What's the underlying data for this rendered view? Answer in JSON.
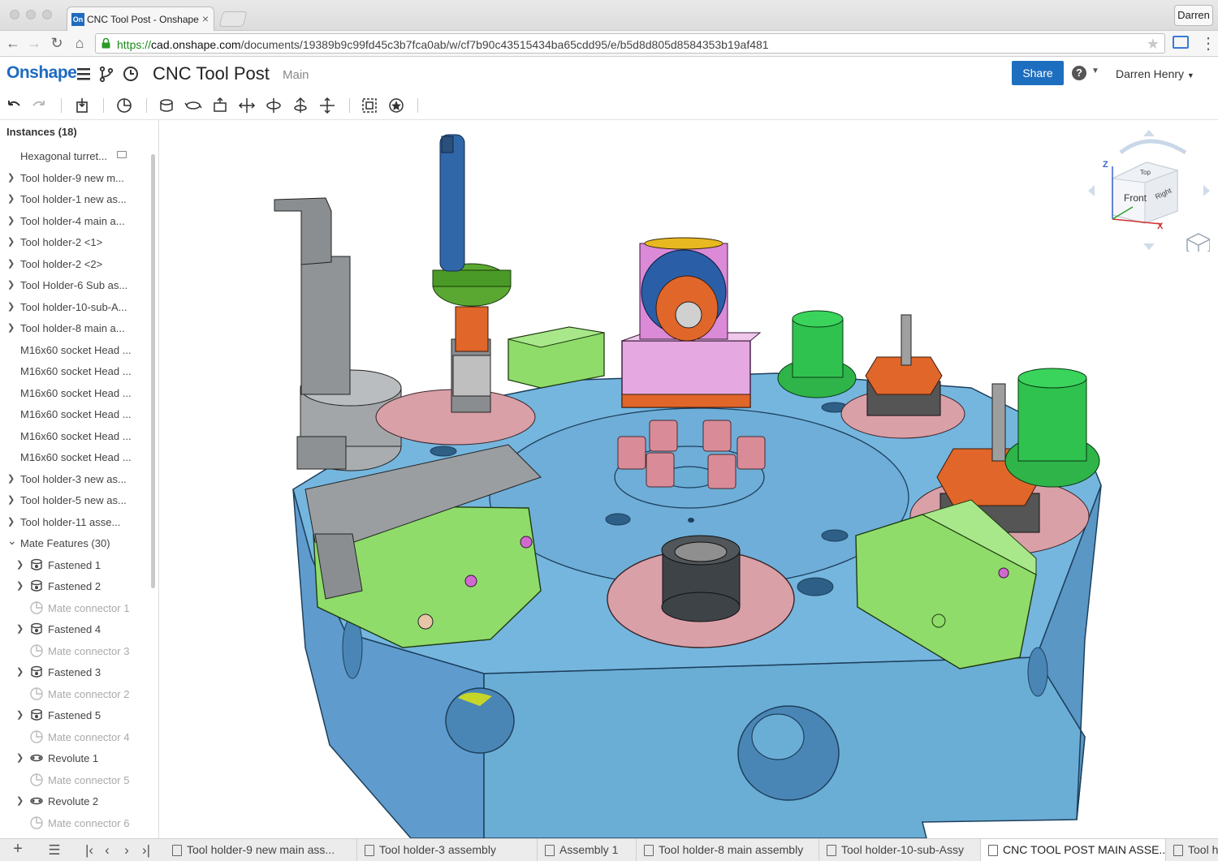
{
  "browser": {
    "tab_title": "CNC Tool Post - Onshape",
    "tab_favicon_text": "On",
    "profile_name": "Darren",
    "url_proto": "https://",
    "url_host": "cad.onshape.com",
    "url_path": "/documents/19389b9c99fd45c3b7fca0ab/w/cf7b90c43515434ba65cdd95/e/b5d8d805d8584353b19af481"
  },
  "header": {
    "logo": "Onshape",
    "doc_title": "CNC Tool Post",
    "branch": "Main",
    "share_label": "Share",
    "help_label": "?",
    "user_name": "Darren Henry"
  },
  "panel": {
    "instances_title": "Instances (18)",
    "instances": [
      {
        "label": "Hexagonal turret...",
        "expandable": false
      },
      {
        "label": "Tool holder-9 new m...",
        "expandable": true
      },
      {
        "label": "Tool holder-1 new as...",
        "expandable": true
      },
      {
        "label": "Tool holder-4 main a...",
        "expandable": true
      },
      {
        "label": "Tool holder-2 <1>",
        "expandable": true
      },
      {
        "label": "Tool holder-2 <2>",
        "expandable": true
      },
      {
        "label": "Tool Holder-6 Sub as...",
        "expandable": true
      },
      {
        "label": "Tool holder-10-sub-A...",
        "expandable": true
      },
      {
        "label": "Tool holder-8 main a...",
        "expandable": true
      },
      {
        "label": "M16x60 socket Head ...",
        "expandable": false
      },
      {
        "label": "M16x60 socket Head ...",
        "expandable": false
      },
      {
        "label": "M16x60 socket Head ...",
        "expandable": false
      },
      {
        "label": "M16x60 socket Head ...",
        "expandable": false
      },
      {
        "label": "M16x60 socket Head ...",
        "expandable": false
      },
      {
        "label": "M16x60 socket Head ...",
        "expandable": false
      },
      {
        "label": "Tool holder-3 new as...",
        "expandable": true
      },
      {
        "label": "Tool holder-5 new as...",
        "expandable": true
      },
      {
        "label": "Tool holder-11 asse...",
        "expandable": true
      }
    ],
    "mates_title": "Mate Features (30)",
    "mates": [
      {
        "label": "Fastened 1",
        "kind": "fastened",
        "dim": false
      },
      {
        "label": "Fastened 2",
        "kind": "fastened",
        "dim": false
      },
      {
        "label": "Mate connector 1",
        "kind": "connector",
        "dim": true
      },
      {
        "label": "Fastened 4",
        "kind": "fastened",
        "dim": false
      },
      {
        "label": "Mate connector 3",
        "kind": "connector",
        "dim": true
      },
      {
        "label": "Fastened 3",
        "kind": "fastened",
        "dim": false
      },
      {
        "label": "Mate connector 2",
        "kind": "connector",
        "dim": true
      },
      {
        "label": "Fastened 5",
        "kind": "fastened",
        "dim": false
      },
      {
        "label": "Mate connector 4",
        "kind": "connector",
        "dim": true
      },
      {
        "label": "Revolute 1",
        "kind": "revolute",
        "dim": false
      },
      {
        "label": "Mate connector 5",
        "kind": "connector",
        "dim": true
      },
      {
        "label": "Revolute 2",
        "kind": "revolute",
        "dim": false
      },
      {
        "label": "Mate connector 6",
        "kind": "connector",
        "dim": true
      }
    ]
  },
  "viewcube": {
    "front": "Front",
    "right": "Right",
    "top": "Top",
    "axis_z": "Z",
    "axis_x": "X"
  },
  "bottom_tabs": [
    {
      "label": "Tool holder-9 new main ass...",
      "active": false
    },
    {
      "label": "Tool holder-3 assembly",
      "active": false
    },
    {
      "label": "Assembly 1",
      "active": false
    },
    {
      "label": "Tool holder-8 main assembly",
      "active": false
    },
    {
      "label": "Tool holder-10-sub-Assy",
      "active": false
    },
    {
      "label": "CNC TOOL POST MAIN ASSE...",
      "active": true
    },
    {
      "label": "Tool h",
      "active": false
    }
  ],
  "colors": {
    "brand": "#1f6bbf",
    "share": "#1e6ec0",
    "turret": "#6aaed6",
    "green_part": "#8fdc6a",
    "pink_part": "#d9a0a8",
    "orange_part": "#e0662a"
  }
}
